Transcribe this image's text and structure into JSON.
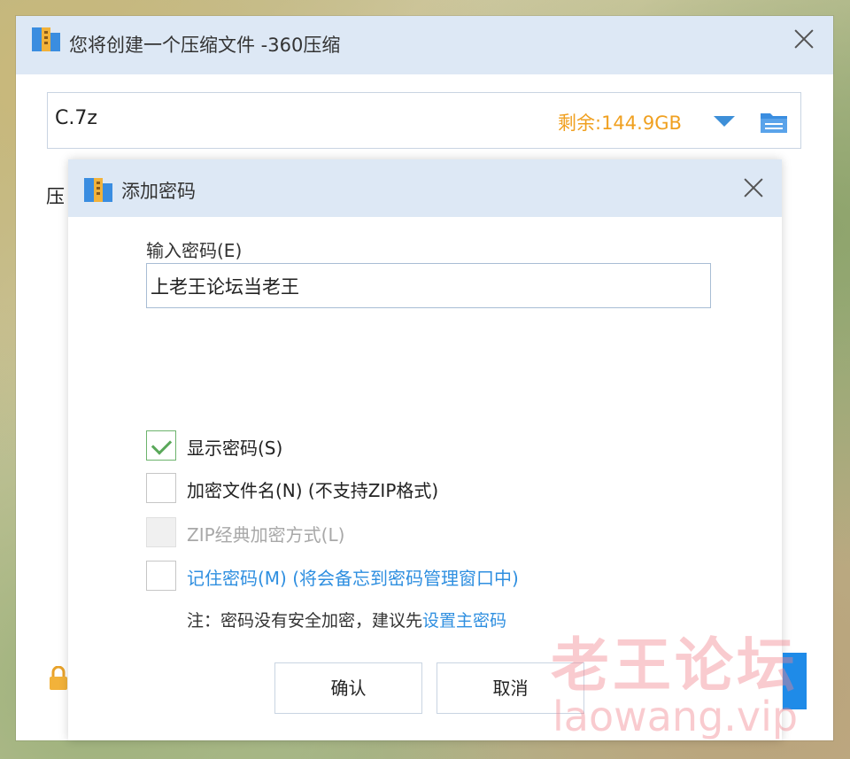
{
  "main_window": {
    "title": "您将创建一个压缩文件 -360压缩",
    "archive_path": "C.7z",
    "free_space": "剩余:144.9GB",
    "left_label_partial": "压"
  },
  "dialog": {
    "title": "添加密码",
    "password_label": "输入密码(E)",
    "password_value": "上老王论坛当老王",
    "options": [
      {
        "label": "显示密码(S)",
        "checked": true,
        "disabled": false,
        "link": false
      },
      {
        "label": "加密文件名(N) (不支持ZIP格式)",
        "checked": false,
        "disabled": false,
        "link": false
      },
      {
        "label": "ZIP经典加密方式(L)",
        "checked": false,
        "disabled": true,
        "link": false
      },
      {
        "label": "记住密码(M) (将会备忘到密码管理窗口中)",
        "checked": false,
        "disabled": false,
        "link": true
      }
    ],
    "note_prefix": "注：密码没有安全加密，建议先",
    "note_link": "设置主密码",
    "confirm_label": "确认",
    "cancel_label": "取消"
  },
  "watermark": {
    "cn": "老王论坛",
    "en": "laowang.vip"
  },
  "colors": {
    "titlebar_bg": "#dde8f5",
    "free_space": "#f0a020",
    "link": "#2f8fe0",
    "check": "#5aa85a"
  },
  "icons": {
    "app": "360zip-archive-icon",
    "folder": "folder-icon",
    "dropdown": "chevron-down-icon",
    "close": "close-icon",
    "lock": "lock-icon"
  }
}
